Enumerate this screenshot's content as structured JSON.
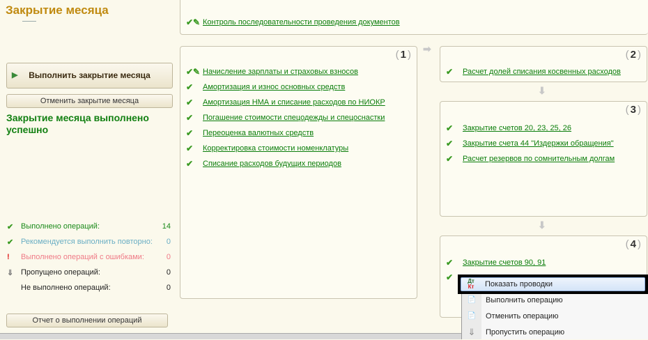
{
  "title": "Закрытие месяца",
  "buttons": {
    "run": "Выполнить закрытие месяца",
    "cancel": "Отменить закрытие месяца",
    "report": "Отчет о выполнении операций"
  },
  "status": "Закрытие месяца выполнено успешно",
  "stats": [
    {
      "label": "Выполнено операций:",
      "value": "14",
      "color": "#1a8a1a",
      "icon": "check-icon"
    },
    {
      "label": "Рекомендуется выполнить повторно:",
      "value": "0",
      "color": "#6aaec4",
      "icon": "check-icon"
    },
    {
      "label": "Выполнено операций с ошибками:",
      "value": "0",
      "color": "#ef7a86",
      "icon": "exclamation-icon"
    },
    {
      "label": "Пропущено операций:",
      "value": "0",
      "color": "#222222",
      "icon": "arrow-down-icon"
    },
    {
      "label": "Не выполнено операций:",
      "value": "0",
      "color": "#222222",
      "icon": ""
    }
  ],
  "top_op": "Контроль последовательности проведения документов",
  "stage1": {
    "num": "1",
    "ops": [
      "Начисление зарплаты и страховых взносов",
      "Амортизация и износ основных средств",
      "Амортизация НМА и списание расходов по НИОКР",
      "Погашение стоимости спецодежды и спецоснастки",
      "Переоценка валютных средств",
      "Корректировка стоимости номенклатуры",
      "Списание расходов будущих периодов"
    ]
  },
  "stage2": {
    "num": "2",
    "ops": [
      "Расчет долей списания косвенных расходов"
    ]
  },
  "stage3": {
    "num": "3",
    "ops": [
      "Закрытие счетов 20, 23, 25, 26",
      "Закрытие счета 44 \"Издержки обращения\"",
      "Расчет резервов по сомнительным долгам"
    ]
  },
  "stage4": {
    "num": "4",
    "ops": [
      "Закрытие счетов 90, 91"
    ]
  },
  "context_menu": [
    "Показать проводки",
    "Выполнить операцию",
    "Отменить операцию",
    "Пропустить операцию"
  ],
  "menu_icon_text": {
    "dt": "Дт",
    "kt": "Кт"
  }
}
